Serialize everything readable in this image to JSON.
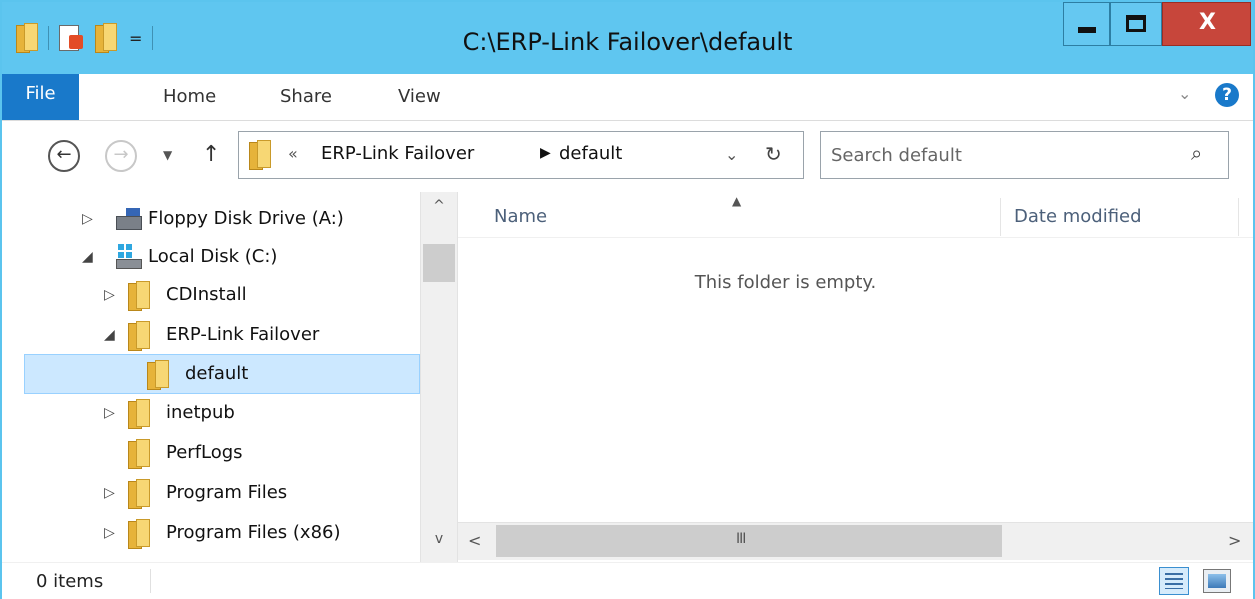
{
  "window": {
    "title": "C:\\ERP-Link Failover\\default",
    "close_label": "X"
  },
  "quick_access": {
    "dropdown": "="
  },
  "ribbon": {
    "tabs": [
      {
        "label": "File"
      },
      {
        "label": "Home"
      },
      {
        "label": "Share"
      },
      {
        "label": "View"
      }
    ],
    "expand_glyph": "⌄",
    "help_glyph": "?"
  },
  "navigation": {
    "back_glyph": "←",
    "forward_glyph": "→",
    "recent_glyph": "▼",
    "up_glyph": "↑"
  },
  "address": {
    "overflow": "«",
    "crumbs": [
      "ERP-Link Failover",
      "default"
    ],
    "separator": "▶",
    "dropdown_glyph": "⌄",
    "refresh_glyph": "↻"
  },
  "search": {
    "placeholder": "Search default",
    "icon": "search-icon"
  },
  "tree": {
    "items": [
      {
        "label": "Floppy Disk Drive (A:)",
        "expander": "▷",
        "icon": "floppy-icon"
      },
      {
        "label": "Local Disk (C:)",
        "expander": "◢",
        "icon": "drive-icon"
      },
      {
        "label": "CDInstall",
        "expander": "▷",
        "icon": "folder-icon"
      },
      {
        "label": "ERP-Link Failover",
        "expander": "◢",
        "icon": "folder-icon"
      },
      {
        "label": "default",
        "expander": "",
        "icon": "folder-icon",
        "selected": true
      },
      {
        "label": "inetpub",
        "expander": "▷",
        "icon": "folder-icon"
      },
      {
        "label": "PerfLogs",
        "expander": "",
        "icon": "folder-icon"
      },
      {
        "label": "Program Files",
        "expander": "▷",
        "icon": "folder-icon"
      },
      {
        "label": "Program Files (x86)",
        "expander": "▷",
        "icon": "folder-icon"
      }
    ]
  },
  "file_list": {
    "columns": [
      "Name",
      "Date modified"
    ],
    "sort_glyph": "▲",
    "empty_message": "This folder is empty."
  },
  "scrollbars": {
    "up": "^",
    "down": "v",
    "left": "<",
    "right": ">",
    "grip": "III"
  },
  "status": {
    "item_count": "0 items"
  },
  "colors": {
    "titlebar": "#5fc6f0",
    "file_tab": "#1979ca",
    "close_button": "#c7463b",
    "selection": "#cce8ff"
  }
}
